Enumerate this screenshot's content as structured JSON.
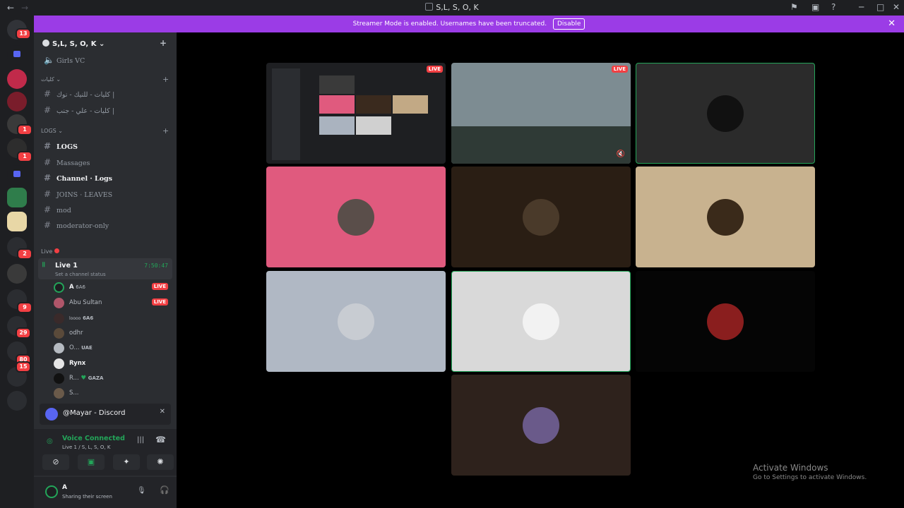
{
  "window": {
    "title": "S,L, S, O, K"
  },
  "banner": {
    "text": "Streamer Mode is enabled. Usernames have been truncated.",
    "button": "Disable"
  },
  "server": {
    "name": "S,L, S, O, K"
  },
  "rail_badges": [
    "13",
    "1",
    "1",
    "2",
    "9",
    "29",
    "80",
    "15"
  ],
  "channels": {
    "top": "Girls VC",
    "cat1": "كليات",
    "c1": "كليات - للنيك - نوك |",
    "c2": "كليات - علي - جنب |",
    "cat2": "LOGS",
    "c3": "LOGS",
    "c4": "Massages",
    "c5": "Channel · Logs",
    "c6": "JOINS · LEAVES",
    "c7": "mod",
    "c8": "moderator-only",
    "cat3": "Live"
  },
  "voice_channel": {
    "name": "Live 1",
    "timer": "7:50:47",
    "status": "Set a channel status"
  },
  "voice_users": [
    {
      "name": "A",
      "tag": "6A6",
      "live": "LIVE"
    },
    {
      "name": "Abu Sultan",
      "tag": "",
      "live": "LIVE"
    },
    {
      "name": "loooo",
      "tag": "6A6",
      "live": ""
    },
    {
      "name": "odhr",
      "tag": "",
      "live": ""
    },
    {
      "name": "O...",
      "tag": "UAE",
      "live": ""
    },
    {
      "name": "Rynx",
      "tag": "",
      "live": ""
    },
    {
      "name": "R...",
      "tag": "GAZA",
      "live": ""
    },
    {
      "name": "S...",
      "tag": "",
      "live": ""
    }
  ],
  "promo": {
    "text": "@Mayar - Discord"
  },
  "voice_panel": {
    "status": "Voice Connected",
    "channel": "Live 1 / S, L, S, O, K"
  },
  "user": {
    "name": "A",
    "status": "Sharing their screen"
  },
  "stage": {
    "live_label": "LIVE"
  },
  "watermark": {
    "line1": "Activate Windows",
    "line2": "Go to Settings to activate Windows."
  },
  "colors": {
    "accent": "#9b3ce6",
    "live": "#f23f43",
    "green": "#23a559"
  }
}
